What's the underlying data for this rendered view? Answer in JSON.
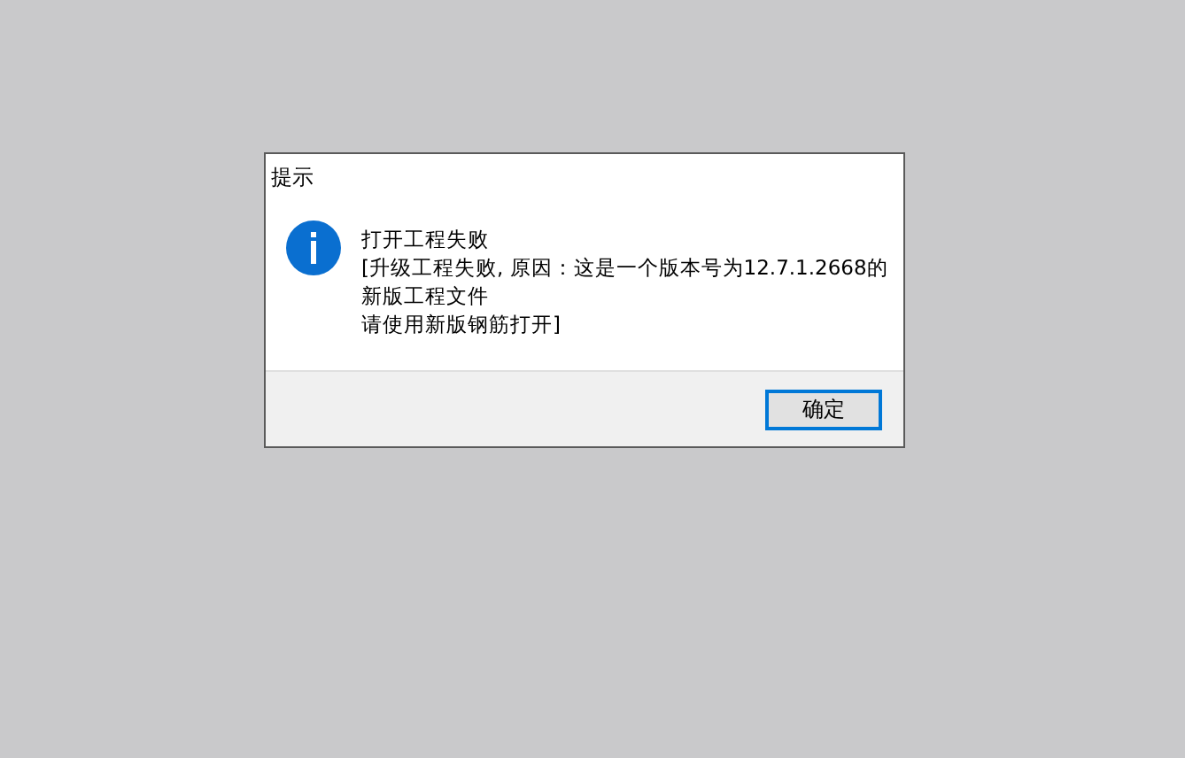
{
  "dialog": {
    "title": "提示",
    "message_lines": [
      "打开工程失败",
      "[升级工程失败, 原因：这是一个版本号为12.7.1.2668的",
      "新版工程文件",
      "请使用新版钢筋打开]"
    ],
    "buttons": [
      {
        "label": "确定",
        "default": true
      }
    ]
  }
}
